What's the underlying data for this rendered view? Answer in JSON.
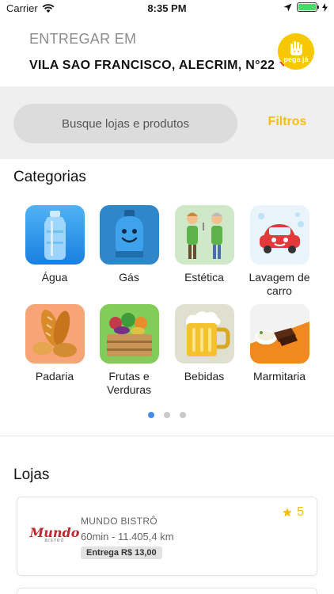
{
  "status_bar": {
    "carrier": "Carrier",
    "time": "8:35 PM"
  },
  "header": {
    "deliver_label": "ENTREGAR EM",
    "address": "VILA SAO FRANCISCO, ALECRIM, N°22",
    "logo_text": "pega já"
  },
  "search": {
    "placeholder": "Busque lojas e produtos",
    "filters_label": "Filtros"
  },
  "categories": {
    "title": "Categorias",
    "items": [
      {
        "label": "Água",
        "icon": "water-jug-icon"
      },
      {
        "label": "Gás",
        "icon": "gas-cylinder-icon"
      },
      {
        "label": "Estética",
        "icon": "barbers-icon"
      },
      {
        "label": "Lavagem de carro",
        "icon": "car-wash-icon"
      },
      {
        "label": "Padaria",
        "icon": "bread-icon"
      },
      {
        "label": "Frutas e Verduras",
        "icon": "vegetables-crate-icon"
      },
      {
        "label": "Bebidas",
        "icon": "beer-mug-icon"
      },
      {
        "label": "Marmitaria",
        "icon": "meal-plate-icon"
      }
    ],
    "pages": 3,
    "active_page": 1
  },
  "stores": {
    "title": "Lojas",
    "items": [
      {
        "name": "MUNDO BISTRÔ",
        "logo_text": "Mundo",
        "meta": "60min - 11.405,4 km",
        "delivery": "Entrega R$ 13,00",
        "rating": "5"
      }
    ]
  },
  "colors": {
    "accent": "#f4be16",
    "address_caret": "#e8302f",
    "active_dot": "#4a8be8"
  }
}
